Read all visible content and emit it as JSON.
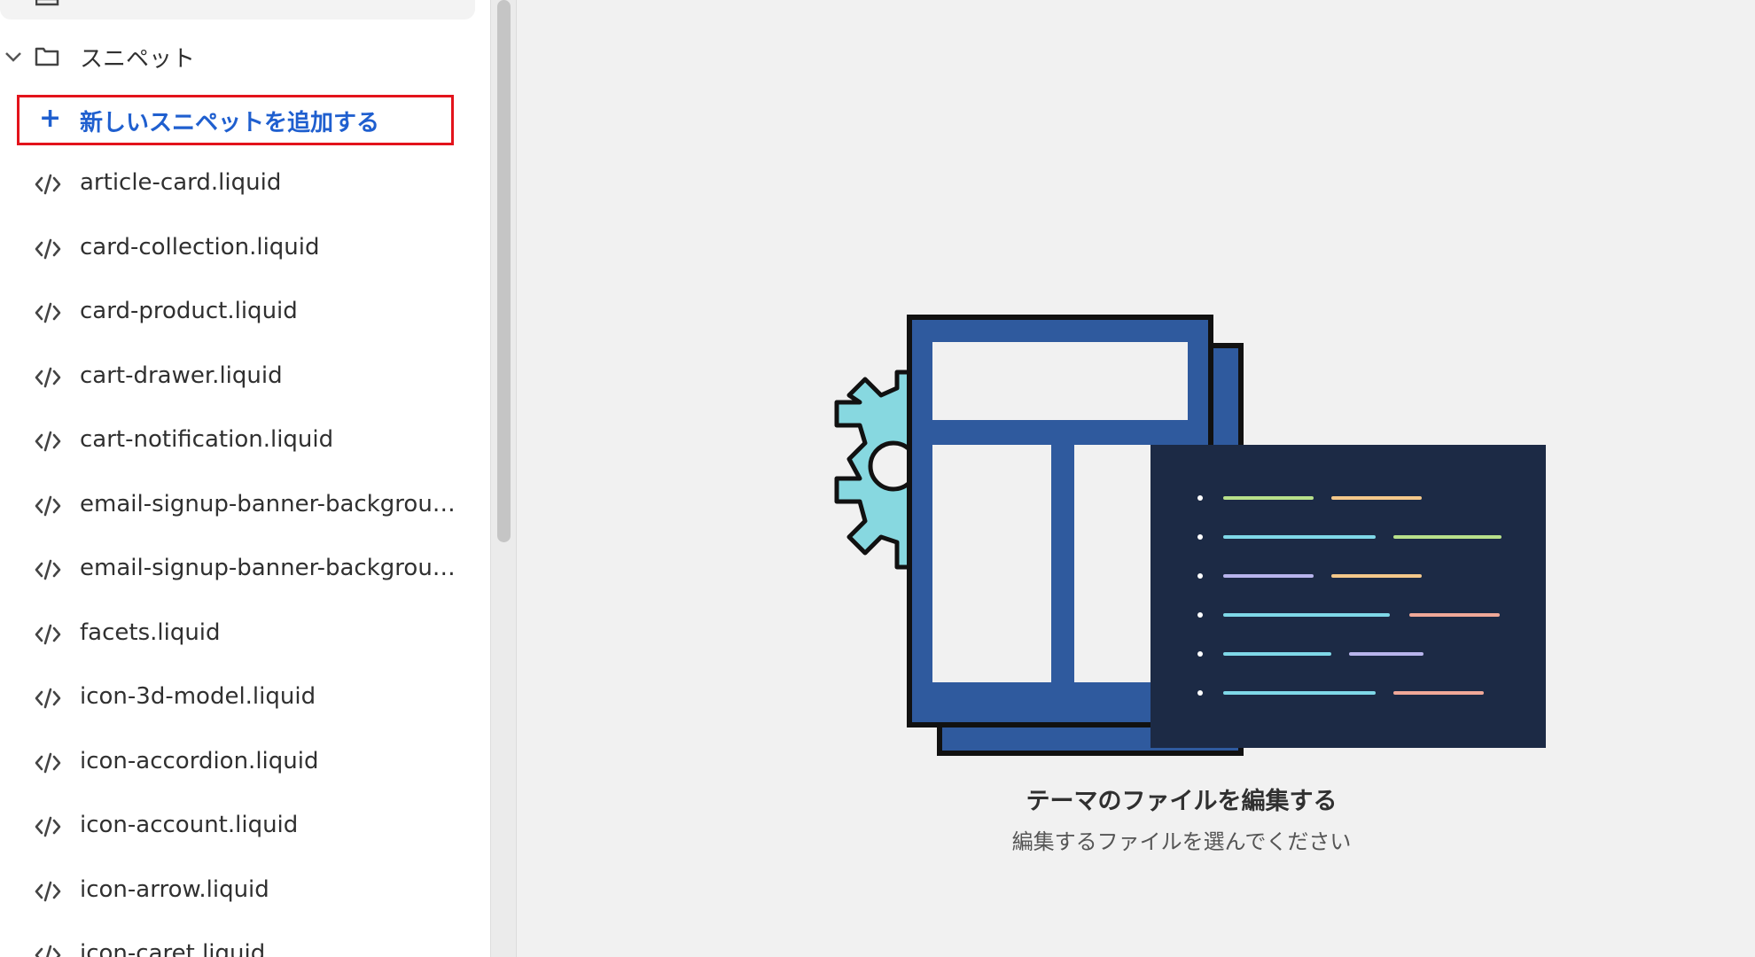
{
  "sidebar": {
    "folder": {
      "label": "スニペット"
    },
    "add_label": "新しいスニペットを追加する",
    "add_icon": "plus-icon",
    "files": [
      "article-card.liquid",
      "card-collection.liquid",
      "card-product.liquid",
      "cart-drawer.liquid",
      "cart-notification.liquid",
      "email-signup-banner-backgroun...",
      "email-signup-banner-backgroun...",
      "facets.liquid",
      "icon-3d-model.liquid",
      "icon-accordion.liquid",
      "icon-account.liquid",
      "icon-arrow.liquid",
      "icon-caret.liquid"
    ]
  },
  "main": {
    "title": "テーマのファイルを編集する",
    "subtitle": "編集するファイルを選んでください"
  },
  "colors": {
    "accent_link": "#1f5fcf",
    "highlight_border": "#e3131b",
    "illustration_blue": "#2f5a9e",
    "illustration_navy": "#1c2a45",
    "gear": "#87d8e0"
  }
}
